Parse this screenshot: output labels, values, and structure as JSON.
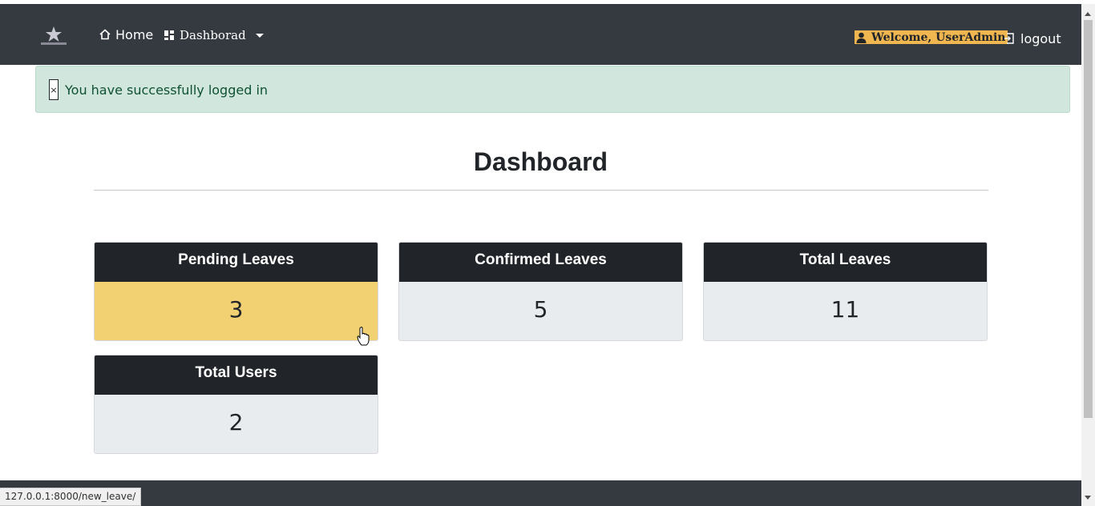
{
  "navbar": {
    "home_label": "Home",
    "dashboard_label": "Dashborad",
    "welcome_label": "Welcome, UserAdmin",
    "logout_label": "logout"
  },
  "alert": {
    "close_symbol": "×",
    "message": "You have successfully logged in"
  },
  "main": {
    "title": "Dashboard",
    "cards": [
      {
        "label": "Pending Leaves",
        "value": "3"
      },
      {
        "label": "Confirmed Leaves",
        "value": "5"
      },
      {
        "label": "Total Leaves",
        "value": "11"
      },
      {
        "label": "Total Users",
        "value": "2"
      }
    ]
  },
  "status_bar": {
    "url": "127.0.0.1:8000/new_leave/"
  },
  "colors": {
    "navbar": "#343a40",
    "card_header": "#212529",
    "pending_highlight": "#f2d173",
    "welcome_badge": "#f0b64f",
    "alert_bg": "#d1e7dd"
  },
  "icons": {
    "home": "home-icon",
    "dashboard": "grid-icon",
    "user": "user-icon",
    "logout": "logout-icon"
  }
}
